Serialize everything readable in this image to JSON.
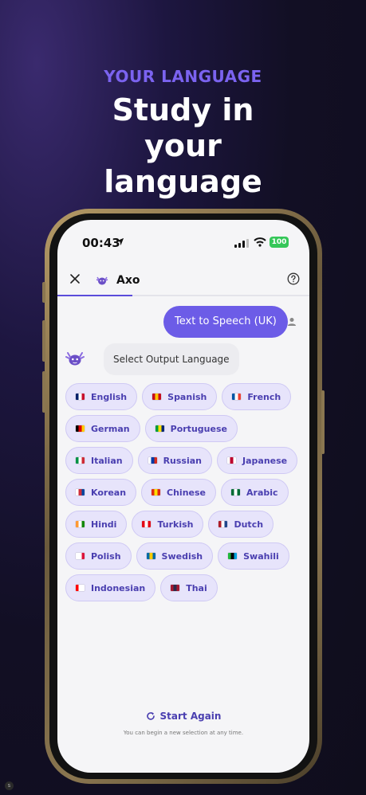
{
  "header": {
    "eyebrow": "YOUR LANGUAGE",
    "headline": "Study in your language"
  },
  "status_bar": {
    "time": "00:43",
    "battery": "100"
  },
  "chat_header": {
    "bot_name": "Axo",
    "icons": [
      "close-icon",
      "axolotl-avatar-icon",
      "help-icon"
    ]
  },
  "chat": {
    "user_message": "Text to Speech (UK)",
    "bot_message": "Select Output Language"
  },
  "languages": [
    {
      "label": "English",
      "flag": [
        "#012169",
        "#ffffff",
        "#c8102e"
      ]
    },
    {
      "label": "Spanish",
      "flag": [
        "#c60b1e",
        "#ffc400",
        "#c60b1e"
      ]
    },
    {
      "label": "French",
      "flag": [
        "#0055a4",
        "#ffffff",
        "#ef4135"
      ]
    },
    {
      "label": "German",
      "flag": [
        "#000000",
        "#dd0000",
        "#ffce00"
      ]
    },
    {
      "label": "Portuguese",
      "flag": [
        "#009c3b",
        "#ffdf00",
        "#002776"
      ]
    },
    {
      "label": "Italian",
      "flag": [
        "#009246",
        "#ffffff",
        "#ce2b37"
      ]
    },
    {
      "label": "Russian",
      "flag": [
        "#ffffff",
        "#0039a6",
        "#d52b1e"
      ]
    },
    {
      "label": "Japanese",
      "flag": [
        "#ffffff",
        "#bc002d",
        "#ffffff"
      ]
    },
    {
      "label": "Korean",
      "flag": [
        "#ffffff",
        "#cd2e3a",
        "#0047a0"
      ]
    },
    {
      "label": "Chinese",
      "flag": [
        "#de2910",
        "#ffde00",
        "#de2910"
      ]
    },
    {
      "label": "Arabic",
      "flag": [
        "#006c35",
        "#ffffff",
        "#006c35"
      ]
    },
    {
      "label": "Hindi",
      "flag": [
        "#ff9933",
        "#ffffff",
        "#138808"
      ]
    },
    {
      "label": "Turkish",
      "flag": [
        "#e30a17",
        "#ffffff",
        "#e30a17"
      ]
    },
    {
      "label": "Dutch",
      "flag": [
        "#ae1c28",
        "#ffffff",
        "#21468b"
      ]
    },
    {
      "label": "Polish",
      "flag": [
        "#ffffff",
        "#ffffff",
        "#dc143c"
      ]
    },
    {
      "label": "Swedish",
      "flag": [
        "#006aa7",
        "#fecc00",
        "#006aa7"
      ]
    },
    {
      "label": "Swahili",
      "flag": [
        "#1eb53a",
        "#000000",
        "#00a3dd"
      ]
    },
    {
      "label": "Indonesian",
      "flag": [
        "#ff0000",
        "#ffffff",
        "#ffffff"
      ]
    },
    {
      "label": "Thai",
      "flag": [
        "#a51931",
        "#2d2a4a",
        "#a51931"
      ]
    }
  ],
  "footer": {
    "start_again": "Start Again",
    "hint": "You can begin a new selection at any time."
  },
  "colors": {
    "accent": "#6c5ce7",
    "chip_bg": "#e7e4fb",
    "chip_text": "#4a3fb0"
  }
}
